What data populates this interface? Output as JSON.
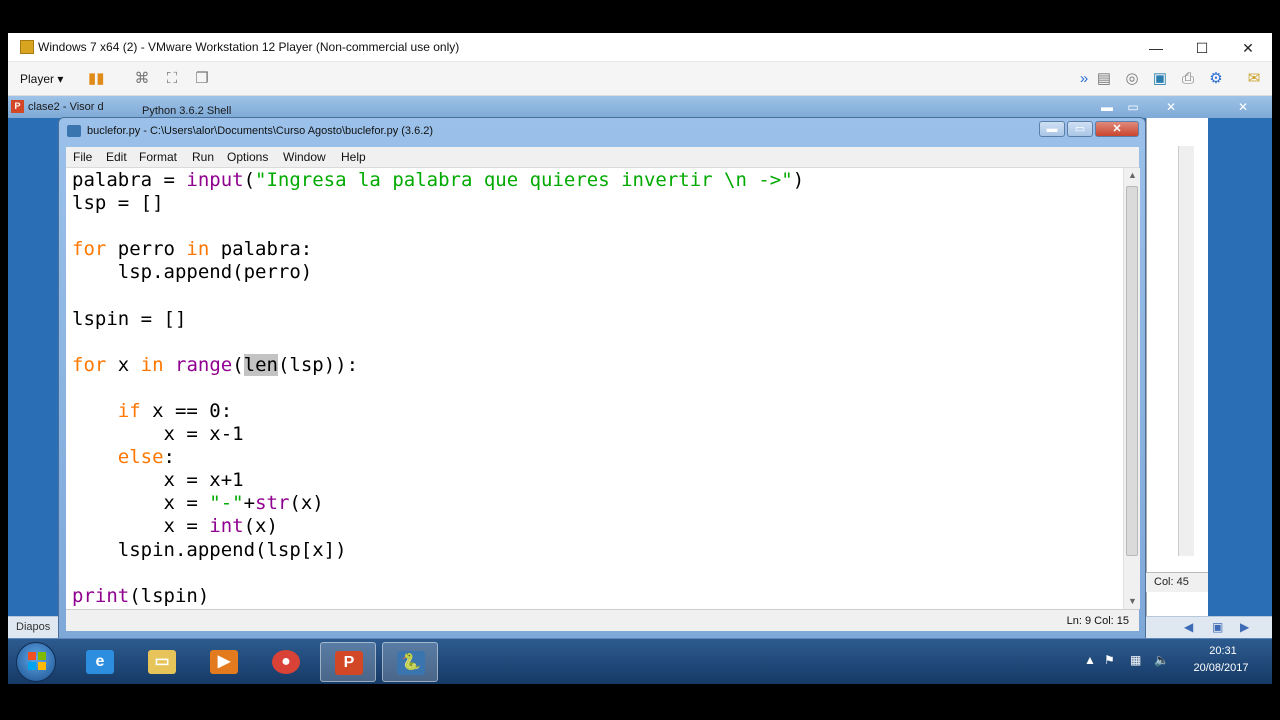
{
  "host": {
    "title": "Windows 7 x64 (2) - VMware Workstation 12 Player (Non-commercial use only)",
    "player_menu": "Player ▾",
    "controls": {
      "minimize": "—",
      "maximize": "☐",
      "close": "✕"
    }
  },
  "guest": {
    "background_window": {
      "ppt_title": "clase2 - Visor d",
      "shell_title": "Python 3.6.2 Shell",
      "status_text": "Diapos",
      "controls": {
        "minimize": "▬",
        "maximize": "▭",
        "close": "✕",
        "close2": "✕"
      }
    },
    "shell": {
      "position": "Col: 45"
    }
  },
  "idle": {
    "title": "buclefor.py - C:\\Users\\alor\\Documents\\Curso Agosto\\buclefor.py (3.6.2)",
    "menu": [
      "File",
      "Edit",
      "Format",
      "Run",
      "Options",
      "Window",
      "Help"
    ],
    "status": "Ln: 9   Col: 15",
    "controls": {
      "minimize": "▬",
      "maximize": "▭",
      "close": "✕"
    },
    "code_lines": [
      "palabra = input(\"Ingresa la palabra que quieres invertir \\n ->\")",
      "lsp = []",
      "",
      "for perro in palabra:",
      "    lsp.append(perro)",
      "",
      "lspin = []",
      "",
      "for x in range(len(lsp)):",
      "",
      "    if x == 0:",
      "        x = x-1",
      "    else:",
      "        x = x+1",
      "        x = \"-\"+str(x)",
      "        x = int(x)",
      "    lspin.append(lsp[x])",
      "",
      "print(lspin)"
    ]
  },
  "taskbar": {
    "clock_time": "20:31",
    "clock_date": "20/08/2017",
    "apps": [
      {
        "name": "Internet Explorer",
        "icon": "ie-icon",
        "glyph": "e"
      },
      {
        "name": "Windows Explorer",
        "icon": "folder-icon",
        "glyph": "▭"
      },
      {
        "name": "Media Player",
        "icon": "media-player-icon",
        "glyph": "▶"
      },
      {
        "name": "Chrome",
        "icon": "chrome-icon",
        "glyph": "●"
      },
      {
        "name": "PowerPoint",
        "icon": "powerpoint-icon",
        "glyph": "P"
      },
      {
        "name": "Python IDLE",
        "icon": "python-icon",
        "glyph": "🐍"
      }
    ],
    "colors": {
      "ie": "#2d8ee0",
      "folder": "#e7c45a",
      "media": "#e37a1e",
      "chrome": "#d94236",
      "ppt": "#d24726",
      "python": "#3a75b0"
    }
  }
}
